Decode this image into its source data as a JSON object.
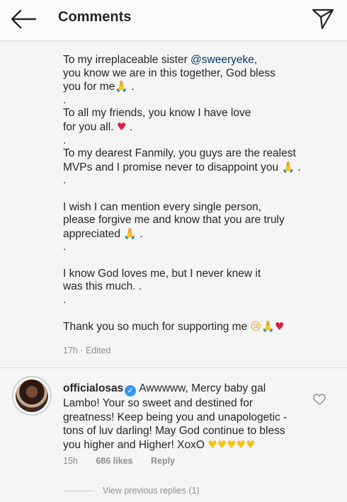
{
  "header": {
    "title": "Comments",
    "back_icon": "arrow-left-icon",
    "send_icon": "paper-plane-icon"
  },
  "caption": {
    "line1": "To my irreplaceable sister ",
    "mention": "@sweeryeke",
    "line1_end": ",",
    "line2": "you know we are in this together, God bless",
    "line3": "you for me",
    "dot": ".",
    "friends1": "To all my friends, you know I have love",
    "friends2": "for you all. ",
    "fanmily1": "To my dearest Fanmily, you guys are the realest",
    "fanmily2": "MVPs and I promise never to disappoint you ",
    "wish1": "I wish I can mention every single person,",
    "wish2": "please forgive me and know that you are truly",
    "wish3": "appreciated ",
    "god1": "I know God loves me, but I never knew it",
    "god2": "was this much. .",
    "thanks": "Thank you so much for supporting me ",
    "time": "17h",
    "edited": "Edited"
  },
  "comment": {
    "username": "officialosas",
    "text": "Awwwww, Mercy baby gal Lambo! Your so sweet and destined for greatness! Keep being you and unapologetic - tons of luv darling! May God continue to bless you higher and Higher! XoxO ",
    "time": "15h",
    "likes": "686 likes",
    "reply": "Reply"
  },
  "replies": {
    "label": "View previous replies (1)"
  },
  "colors": {
    "mention": "#003569",
    "verified": "#3897f0",
    "meta": "#8e8e8e"
  }
}
